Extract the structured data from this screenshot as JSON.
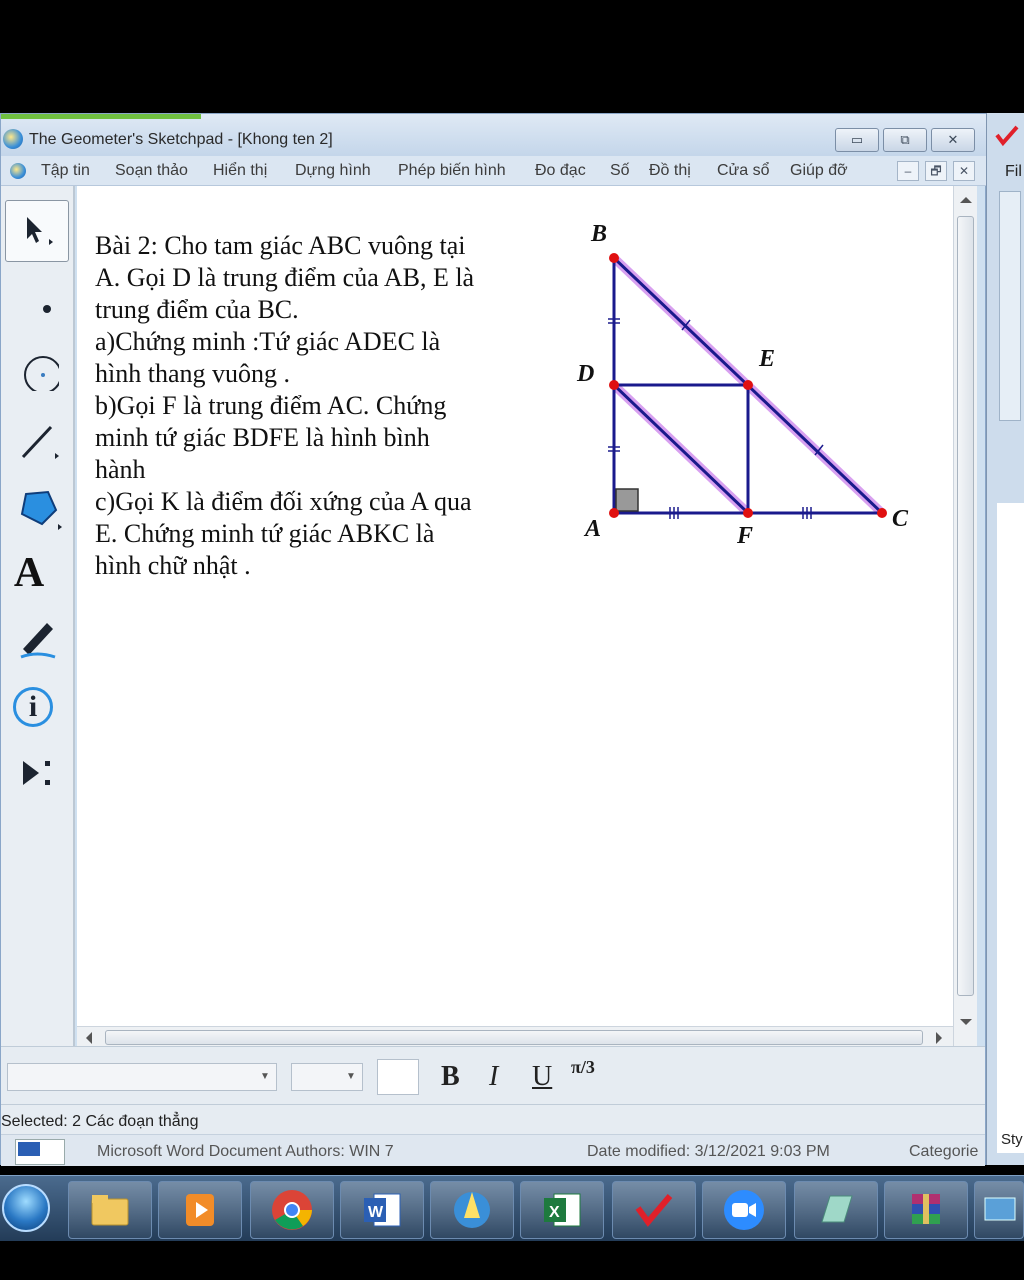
{
  "window": {
    "title": "The Geometer's Sketchpad - [Khong ten 2]",
    "controls": {
      "minimize": "▭",
      "restore": "⧉",
      "close": "✕"
    }
  },
  "menu": {
    "items": [
      "Tập tin",
      "Soạn thảo",
      "Hiển thị",
      "Dựng hình",
      "Phép biến hình",
      "Đo đạc",
      "Số",
      "Đồ thị",
      "Cửa sổ",
      "Giúp đỡ"
    ],
    "mdi": {
      "minimize": "–",
      "restore": "🗗",
      "close": "✕"
    }
  },
  "toolbox": {
    "tools": [
      "arrow-select",
      "point",
      "compass",
      "straightedge",
      "polygon",
      "text",
      "marker",
      "information",
      "custom-tools"
    ],
    "text_tool_glyph": "A",
    "info_tool_glyph": "i"
  },
  "canvas": {
    "problem_lines": [
      "Bài 2:  Cho tam giác ABC vuông tại",
      "A. Gọi D là trung điểm của AB, E là",
      "trung điểm của BC.",
      "a)Chứng minh :Tứ giác ADEC là",
      "hình thang vuông .",
      "b)Gọi F là trung điểm AC. Chứng",
      "minh tứ giác BDFE là hình bình",
      "hành",
      "c)Gọi K là điểm đối xứng của A qua",
      "E. Chứng minh tứ giác ABKC là",
      "hình chữ nhật ."
    ],
    "figure": {
      "points": {
        "A": "A",
        "B": "B",
        "C": "C",
        "D": "D",
        "E": "E",
        "F": "F"
      },
      "segment_color": "#1a1a8c",
      "highlight_color": "#d8a0f0",
      "point_color": "#e01010"
    }
  },
  "formatbar": {
    "bold": "B",
    "italic": "I",
    "underline": "U",
    "math_format": "π/3"
  },
  "status": {
    "text": "Selected: 2 Các đoạn thẳng"
  },
  "details": {
    "type_authors": "Microsoft Word Document  Authors:  WIN 7",
    "date_modified": "Date modified:  3/12/2021 9:03 PM",
    "category": "Categorie"
  },
  "right_window": {
    "menu_label": "Fil",
    "style_label": "Sty"
  },
  "taskbar": {
    "apps": [
      "file-explorer",
      "media-player",
      "chrome",
      "word",
      "sketchpad",
      "excel",
      "math-app",
      "zoom",
      "notes",
      "winrar",
      "screen"
    ]
  }
}
